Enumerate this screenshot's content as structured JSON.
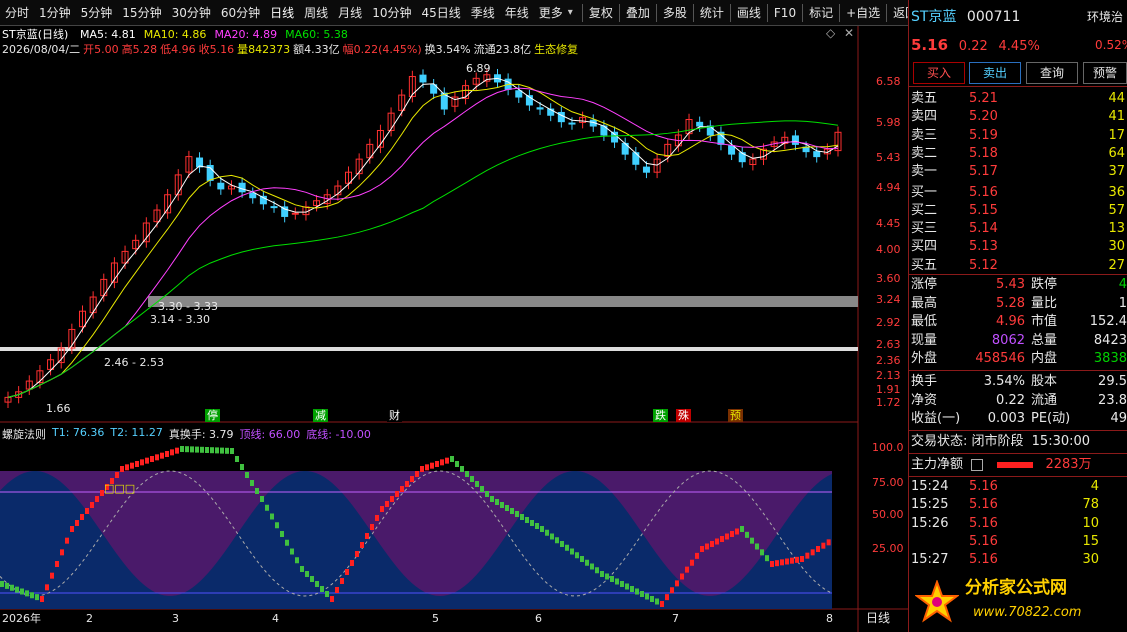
{
  "toolbar": {
    "periods": [
      "分时",
      "1分钟",
      "5分钟",
      "15分钟",
      "30分钟",
      "60分钟",
      "日线",
      "周线",
      "月线",
      "10分钟",
      "45日线",
      "季线",
      "年线",
      "更多"
    ],
    "active_period": "日线",
    "actions": [
      "复权",
      "叠加",
      "多股",
      "统计",
      "画线",
      "F10",
      "标记",
      "+自选",
      "返回"
    ]
  },
  "chart": {
    "title": "ST京蓝(日线)",
    "ma": [
      {
        "label": "MA5: 4.81",
        "color": "#ffffff"
      },
      {
        "label": "MA10: 4.86",
        "color": "#e8e800"
      },
      {
        "label": "MA20: 4.89",
        "color": "#ff40ff"
      },
      {
        "label": "MA60: 5.38",
        "color": "#00e000"
      }
    ],
    "info_date": "2026/08/04/二",
    "info_open": "开5.00",
    "info_high": "高5.28",
    "info_low": "低4.96",
    "info_close": "收5.16",
    "info_vol": "量842373",
    "info_amount": "额4.33亿",
    "info_change": "幅0.22(4.45%)",
    "info_turnover": "换3.54%",
    "info_float": "流通23.8亿",
    "info_eco": "生态修复",
    "y_ticks": [
      "6.58",
      "5.98",
      "5.43",
      "4.94",
      "4.45",
      "4.00",
      "3.60",
      "3.24",
      "2.92",
      "2.63",
      "2.36",
      "2.13",
      "1.91",
      "1.72"
    ],
    "peak_label": "6.89",
    "low_label": "1.66",
    "range_labels": [
      "3.30 - 3.33",
      "3.14 - 3.30",
      "2.46 - 2.53"
    ],
    "signals": [
      {
        "text": "停",
        "color": "#ffffff",
        "bg": "#00a000"
      },
      {
        "text": "减",
        "color": "#ffffff",
        "bg": "#00a000"
      },
      {
        "text": "财",
        "color": "#ffffff",
        "bg": "#000000"
      },
      {
        "text": "跌",
        "color": "#ffffff",
        "bg": "#00a000"
      },
      {
        "text": "殊",
        "color": "#ffffff",
        "bg": "#c00000"
      },
      {
        "text": "预",
        "color": "#e8e800",
        "bg": "#7a3000"
      }
    ],
    "dates": [
      "2026年",
      "2",
      "3",
      "4",
      "5",
      "6",
      "7",
      "8"
    ],
    "period_button": "日线"
  },
  "indicator": {
    "name": "螺旋法则",
    "t1": "T1: 76.36",
    "t2": "T2: 11.27",
    "zs": "真换手: 3.79",
    "top": "顶线: 66.00",
    "bottom": "底线: -10.00",
    "y_ticks": [
      "100.0",
      "75.00",
      "50.00",
      "25.00"
    ],
    "chinese_marker": "□□□"
  },
  "chart_data": {
    "type": "candlestick",
    "title": "ST京蓝(日线)",
    "ylim": [
      1.6,
      7.0
    ],
    "close_series": [
      1.66,
      1.7,
      1.78,
      1.86,
      1.95,
      2.05,
      2.22,
      2.4,
      2.55,
      2.75,
      2.95,
      3.1,
      3.25,
      3.5,
      3.7,
      3.95,
      4.3,
      4.65,
      4.45,
      4.2,
      4.05,
      4.1,
      4.0,
      3.9,
      3.8,
      3.75,
      3.6,
      3.65,
      3.75,
      3.85,
      3.95,
      4.1,
      4.35,
      4.6,
      4.9,
      5.2,
      5.6,
      6.05,
      6.55,
      6.4,
      6.1,
      5.7,
      6.0,
      6.3,
      6.5,
      6.6,
      6.4,
      6.2,
      6.0,
      5.8,
      5.7,
      5.55,
      5.4,
      5.35,
      5.5,
      5.3,
      5.1,
      4.95,
      4.7,
      4.5,
      4.35,
      4.6,
      4.9,
      5.1,
      5.45,
      5.3,
      5.1,
      4.9,
      4.7,
      4.55,
      4.6,
      4.8,
      4.95,
      5.05,
      4.9,
      4.75,
      4.65,
      4.8,
      5.16
    ]
  },
  "right_panel": {
    "name": "ST京蓝",
    "code": "000711",
    "env": "环境治",
    "price": "5.16",
    "change": "0.22",
    "change_pct": "4.45%",
    "side_pct": "0.52%",
    "buttons": [
      "买入",
      "卖出",
      "查询",
      "预警"
    ],
    "asks": [
      {
        "label": "卖五",
        "price": "5.21",
        "vol": "44"
      },
      {
        "label": "卖四",
        "price": "5.20",
        "vol": "41"
      },
      {
        "label": "卖三",
        "price": "5.19",
        "vol": "17"
      },
      {
        "label": "卖二",
        "price": "5.18",
        "vol": "64"
      },
      {
        "label": "卖一",
        "price": "5.17",
        "vol": "37"
      }
    ],
    "bids": [
      {
        "label": "买一",
        "price": "5.16",
        "vol": "36"
      },
      {
        "label": "买二",
        "price": "5.15",
        "vol": "57"
      },
      {
        "label": "买三",
        "price": "5.14",
        "vol": "13"
      },
      {
        "label": "买四",
        "price": "5.13",
        "vol": "30"
      },
      {
        "label": "买五",
        "price": "5.12",
        "vol": "27"
      }
    ],
    "stats": [
      {
        "l1": "涨停",
        "v1": "5.43",
        "c1": "red",
        "l2": "跌停",
        "v2": "4",
        "c2": "green"
      },
      {
        "l1": "最高",
        "v1": "5.28",
        "c1": "red",
        "l2": "量比",
        "v2": "1",
        "c2": "white"
      },
      {
        "l1": "最低",
        "v1": "4.96",
        "c1": "red",
        "l2": "市值",
        "v2": "152.4",
        "c2": "white"
      },
      {
        "l1": "现量",
        "v1": "8062",
        "c1": "purple",
        "l2": "总量",
        "v2": "8423",
        "c2": "white"
      },
      {
        "l1": "外盘",
        "v1": "458546",
        "c1": "red",
        "l2": "内盘",
        "v2": "3838",
        "c2": "green"
      }
    ],
    "stats2": [
      {
        "l1": "换手",
        "v1": "3.54%",
        "l2": "股本",
        "v2": "29.5"
      },
      {
        "l1": "净资",
        "v1": "0.22",
        "l2": "流通",
        "v2": "23.8"
      },
      {
        "l1": "收益(一)",
        "v1": "0.003",
        "l2": "PE(动)",
        "v2": "49"
      }
    ],
    "trade_status": "交易状态: 闭市阶段",
    "trade_time": "15:30:00",
    "main_net": "主力净额",
    "main_net_value": "2283万",
    "ticks": [
      {
        "t": "15:24",
        "p": "5.16",
        "v": "4"
      },
      {
        "t": "15:25",
        "p": "5.16",
        "v": "78"
      },
      {
        "t": "15:26",
        "p": "5.16",
        "v": "10"
      },
      {
        "t": "",
        "p": "5.16",
        "v": "15"
      },
      {
        "t": "15:27",
        "p": "5.16",
        "v": "30"
      }
    ],
    "logo_text": "分析家公式网",
    "logo_url": "www.70822.com"
  }
}
